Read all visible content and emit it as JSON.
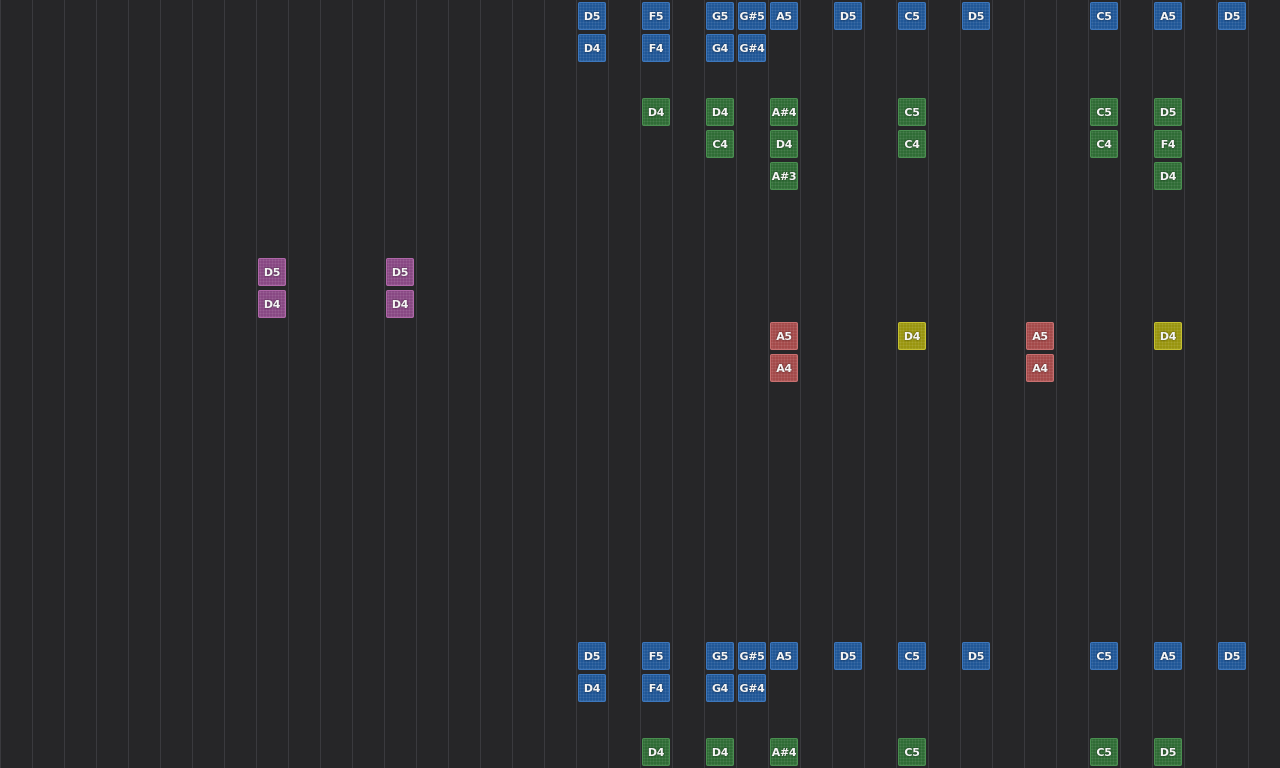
{
  "colors": {
    "background": "#262628",
    "grid_line": "#3a3a3e",
    "blue": "#1e5596",
    "green": "#2d6a33",
    "purple": "#874682",
    "red": "#a34848",
    "yellow": "#98940c"
  },
  "notes": [
    {
      "col": 18,
      "row": 0,
      "label": "D5",
      "color": "blue"
    },
    {
      "col": 20,
      "row": 0,
      "label": "F5",
      "color": "blue"
    },
    {
      "col": 22,
      "row": 0,
      "label": "G5",
      "color": "blue"
    },
    {
      "col": 23,
      "row": 0,
      "label": "G#5",
      "color": "blue"
    },
    {
      "col": 24,
      "row": 0,
      "label": "A5",
      "color": "blue"
    },
    {
      "col": 26,
      "row": 0,
      "label": "D5",
      "color": "blue"
    },
    {
      "col": 28,
      "row": 0,
      "label": "C5",
      "color": "blue"
    },
    {
      "col": 30,
      "row": 0,
      "label": "D5",
      "color": "blue"
    },
    {
      "col": 34,
      "row": 0,
      "label": "C5",
      "color": "blue"
    },
    {
      "col": 36,
      "row": 0,
      "label": "A5",
      "color": "blue"
    },
    {
      "col": 38,
      "row": 0,
      "label": "D5",
      "color": "blue"
    },
    {
      "col": 18,
      "row": 1,
      "label": "D4",
      "color": "blue"
    },
    {
      "col": 20,
      "row": 1,
      "label": "F4",
      "color": "blue"
    },
    {
      "col": 22,
      "row": 1,
      "label": "G4",
      "color": "blue"
    },
    {
      "col": 23,
      "row": 1,
      "label": "G#4",
      "color": "blue"
    },
    {
      "col": 20,
      "row": 3,
      "label": "D4",
      "color": "green"
    },
    {
      "col": 22,
      "row": 3,
      "label": "D4",
      "color": "green"
    },
    {
      "col": 24,
      "row": 3,
      "label": "A#4",
      "color": "green"
    },
    {
      "col": 28,
      "row": 3,
      "label": "C5",
      "color": "green"
    },
    {
      "col": 34,
      "row": 3,
      "label": "C5",
      "color": "green"
    },
    {
      "col": 36,
      "row": 3,
      "label": "D5",
      "color": "green"
    },
    {
      "col": 22,
      "row": 4,
      "label": "C4",
      "color": "green"
    },
    {
      "col": 24,
      "row": 4,
      "label": "D4",
      "color": "green"
    },
    {
      "col": 28,
      "row": 4,
      "label": "C4",
      "color": "green"
    },
    {
      "col": 34,
      "row": 4,
      "label": "C4",
      "color": "green"
    },
    {
      "col": 36,
      "row": 4,
      "label": "F4",
      "color": "green"
    },
    {
      "col": 24,
      "row": 5,
      "label": "A#3",
      "color": "green"
    },
    {
      "col": 36,
      "row": 5,
      "label": "D4",
      "color": "green"
    },
    {
      "col": 8,
      "row": 8,
      "label": "D5",
      "color": "purple"
    },
    {
      "col": 12,
      "row": 8,
      "label": "D5",
      "color": "purple"
    },
    {
      "col": 8,
      "row": 9,
      "label": "D4",
      "color": "purple"
    },
    {
      "col": 12,
      "row": 9,
      "label": "D4",
      "color": "purple"
    },
    {
      "col": 24,
      "row": 10,
      "label": "A5",
      "color": "red"
    },
    {
      "col": 28,
      "row": 10,
      "label": "D4",
      "color": "yellow"
    },
    {
      "col": 32,
      "row": 10,
      "label": "A5",
      "color": "red"
    },
    {
      "col": 36,
      "row": 10,
      "label": "D4",
      "color": "yellow"
    },
    {
      "col": 24,
      "row": 11,
      "label": "A4",
      "color": "red"
    },
    {
      "col": 32,
      "row": 11,
      "label": "A4",
      "color": "red"
    },
    {
      "col": 18,
      "row": 20,
      "label": "D5",
      "color": "blue"
    },
    {
      "col": 20,
      "row": 20,
      "label": "F5",
      "color": "blue"
    },
    {
      "col": 22,
      "row": 20,
      "label": "G5",
      "color": "blue"
    },
    {
      "col": 23,
      "row": 20,
      "label": "G#5",
      "color": "blue"
    },
    {
      "col": 24,
      "row": 20,
      "label": "A5",
      "color": "blue"
    },
    {
      "col": 26,
      "row": 20,
      "label": "D5",
      "color": "blue"
    },
    {
      "col": 28,
      "row": 20,
      "label": "C5",
      "color": "blue"
    },
    {
      "col": 30,
      "row": 20,
      "label": "D5",
      "color": "blue"
    },
    {
      "col": 34,
      "row": 20,
      "label": "C5",
      "color": "blue"
    },
    {
      "col": 36,
      "row": 20,
      "label": "A5",
      "color": "blue"
    },
    {
      "col": 38,
      "row": 20,
      "label": "D5",
      "color": "blue"
    },
    {
      "col": 18,
      "row": 21,
      "label": "D4",
      "color": "blue"
    },
    {
      "col": 20,
      "row": 21,
      "label": "F4",
      "color": "blue"
    },
    {
      "col": 22,
      "row": 21,
      "label": "G4",
      "color": "blue"
    },
    {
      "col": 23,
      "row": 21,
      "label": "G#4",
      "color": "blue"
    },
    {
      "col": 20,
      "row": 23,
      "label": "D4",
      "color": "green"
    },
    {
      "col": 22,
      "row": 23,
      "label": "D4",
      "color": "green"
    },
    {
      "col": 24,
      "row": 23,
      "label": "A#4",
      "color": "green"
    },
    {
      "col": 28,
      "row": 23,
      "label": "C5",
      "color": "green"
    },
    {
      "col": 34,
      "row": 23,
      "label": "C5",
      "color": "green"
    },
    {
      "col": 36,
      "row": 23,
      "label": "D5",
      "color": "green"
    }
  ]
}
